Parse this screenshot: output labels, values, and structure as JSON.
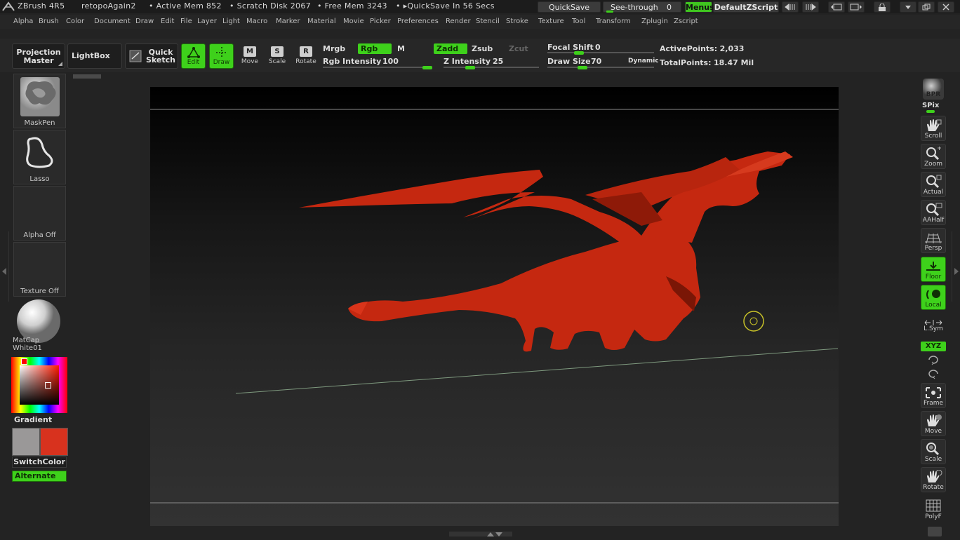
{
  "titlebar": {
    "app": "ZBrush 4R5",
    "doc": "retopoAgain2",
    "active_mem": "• Active Mem 852",
    "scratch": "• Scratch Disk 2067",
    "free_mem": "• Free Mem 3243",
    "quicksave_timer": "• ▸QuickSave In 56 Secs",
    "quicksave_btn": "QuickSave",
    "seethrough_label": "See-through",
    "seethrough_value": "0",
    "menus_btn": "Menus",
    "script_name": "DefaultZScript"
  },
  "menu": [
    "Alpha",
    "Brush",
    "Color",
    "Document",
    "Draw",
    "Edit",
    "File",
    "Layer",
    "Light",
    "Macro",
    "Marker",
    "Material",
    "Movie",
    "Picker",
    "Preferences",
    "Render",
    "Stencil",
    "Stroke",
    "Texture",
    "Tool",
    "Transform",
    "Zplugin",
    "Zscript"
  ],
  "shelf": {
    "projection_master": "Projection Master",
    "lightbox": "LightBox",
    "quick_sketch": "Quick Sketch",
    "edit": "Edit",
    "draw": "Draw",
    "move": "Move",
    "scale": "Scale",
    "rotate": "Rotate",
    "move_key": "M",
    "scale_key": "S",
    "rotate_key": "R",
    "mrgb": "Mrgb",
    "rgb": "Rgb",
    "m": "M",
    "rgb_intensity_label": "Rgb Intensity",
    "rgb_intensity": "100",
    "rgb_intensity_value": 100,
    "zadd": "Zadd",
    "zsub": "Zsub",
    "zcut": "Zcut",
    "z_intensity_label": "Z Intensity",
    "z_intensity": "25",
    "z_intensity_value": 25,
    "focal_shift_label": "Focal Shift",
    "focal_shift": "0",
    "focal_shift_value": 0,
    "draw_size_label": "Draw Size",
    "draw_size": "70",
    "draw_size_value": 70,
    "dynamic": "Dynamic",
    "active_points_label": "ActivePoints:",
    "active_points": "2,033",
    "total_points_label": "TotalPoints:",
    "total_points": "18.47 Mil"
  },
  "left": {
    "brush": "MaskPen",
    "stroke": "Lasso",
    "alpha": "Alpha Off",
    "texture": "Texture Off",
    "material": "MatCap White01",
    "gradient": "Gradient",
    "switchcolor": "SwitchColor",
    "alternate": "Alternate"
  },
  "right": {
    "bpr": "BPR",
    "spix": "SPix",
    "scroll": "Scroll",
    "zoom": "Zoom",
    "actual": "Actual",
    "aahalf": "AAHalf",
    "persp": "Persp",
    "floor": "Floor",
    "local": "Local",
    "lsym": "L.Sym",
    "xyz": "XYZ",
    "frame": "Frame",
    "move": "Move",
    "scale": "Scale",
    "rotate": "Rotate",
    "polyf": "PolyF"
  },
  "colors": {
    "accent_green": "#3ed11b",
    "model_red": "#c82a12",
    "main_color": "#d8321e",
    "secondary_color": "#9a9898"
  }
}
